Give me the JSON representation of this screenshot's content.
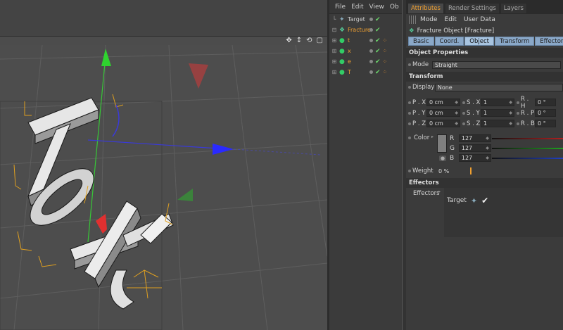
{
  "object_manager": {
    "menu": [
      "File",
      "Edit",
      "View",
      "Ob"
    ],
    "objects": [
      {
        "name": "Target",
        "selected": false
      },
      {
        "name": "Fracture",
        "selected": true
      },
      {
        "name": "t",
        "selected": false
      },
      {
        "name": "x",
        "selected": false
      },
      {
        "name": "e",
        "selected": false
      },
      {
        "name": "T",
        "selected": false
      }
    ]
  },
  "attributes": {
    "tabs": [
      "Attributes",
      "Render Settings",
      "Layers"
    ],
    "active_tab": "Attributes",
    "menu": [
      "Mode",
      "Edit",
      "User Data"
    ],
    "object_title": "Fracture Object [Fracture]",
    "buttons": [
      "Basic",
      "Coord.",
      "Object",
      "Transform",
      "Effectors"
    ],
    "active_button": "Object",
    "section_object_properties": "Object Properties",
    "mode_label": "Mode",
    "mode_value": "Straight",
    "section_transform": "Transform",
    "display_label": "Display",
    "display_value": "None",
    "transform_rows": [
      {
        "p_label": "P . X",
        "p_val": "0 cm",
        "s_label": "S . X",
        "s_val": "1",
        "r_label": "R . H",
        "r_val": "0 °"
      },
      {
        "p_label": "P . Y",
        "p_val": "0 cm",
        "s_label": "S . Y",
        "s_val": "1",
        "r_label": "R . P",
        "r_val": "0 °"
      },
      {
        "p_label": "P . Z",
        "p_val": "0 cm",
        "s_label": "S . Z",
        "s_val": "1",
        "r_label": "R . B",
        "r_val": "0 °"
      }
    ],
    "color_label": "Color",
    "color_channels": [
      {
        "label": "R",
        "value": "127",
        "bar_color": "#c82828"
      },
      {
        "label": "G",
        "value": "127",
        "bar_color": "#28a028"
      },
      {
        "label": "B",
        "value": "127",
        "bar_color": "#2848c8"
      }
    ],
    "weight_label": "Weight",
    "weight_value": "0 %",
    "section_effectors": "Effectors",
    "effectors_label": "Effectors",
    "effector_item": "Target"
  }
}
